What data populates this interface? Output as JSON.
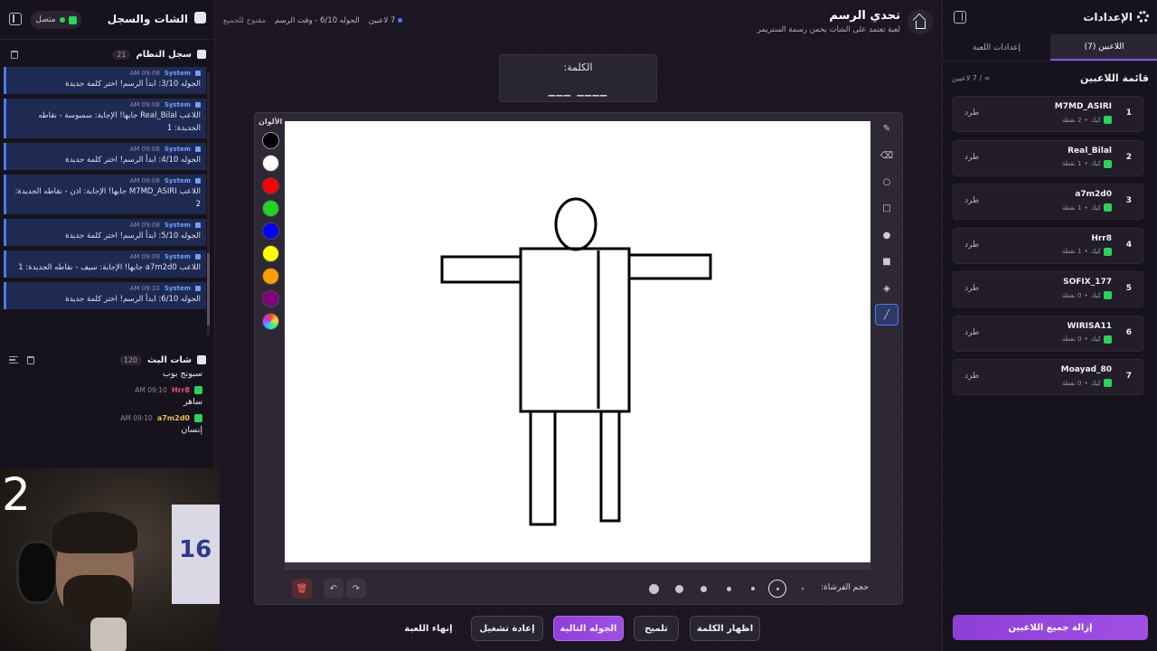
{
  "left_panel": {
    "title": "الشات والسجل",
    "status": "متصل",
    "system_log": {
      "title": "سجل النظام",
      "count": "21",
      "entries": [
        {
          "source": "System",
          "time": "09:08 AM",
          "text": "الجوله 3/10: ابدأ الرسم! اختر كلمة جديدة"
        },
        {
          "source": "System",
          "time": "09:08 AM",
          "text": "اللاعب Real_Bilal جابها! الإجابة: سمبوسة - نقاطه الجديدة: 1"
        },
        {
          "source": "System",
          "time": "09:08 AM",
          "text": "الجوله 4/10: ابدأ الرسم! اختر كلمة جديدة"
        },
        {
          "source": "System",
          "time": "09:08 AM",
          "text": "اللاعب M7MD_ASIRI جابها! الإجابة: اذن - نقاطه الجديدة: 2"
        },
        {
          "source": "System",
          "time": "09:08 AM",
          "text": "الجوله 5/10: ابدأ الرسم! اختر كلمة جديدة"
        },
        {
          "source": "System",
          "time": "09:09 AM",
          "text": "اللاعب a7m2d0 جابها! الإجابة: سيف - نقاطه الجديدة: 1"
        },
        {
          "source": "System",
          "time": "09:10 AM",
          "text": "الجوله 6/10: ابدأ الرسم! اختر كلمة جديدة"
        }
      ]
    },
    "stream_chat": {
      "title": "شات البث",
      "count": "120",
      "messages": [
        {
          "user": "",
          "time": "",
          "text": "سبونج بوب",
          "color": "#ffffff"
        },
        {
          "user": "Hrr8",
          "time": "09:10 AM",
          "text": "ساهر",
          "color": "#e0566b"
        },
        {
          "user": "a7m2d0",
          "time": "09:10 AM",
          "text": "إنسان",
          "color": "#e8c25a"
        }
      ]
    },
    "webcam": {
      "overlay_number": "2",
      "poster_text": "16"
    }
  },
  "header": {
    "title": "تحدي الرسم",
    "subtitle": "لعبة تعتمد على الشات يخمن رسمة الستريمر",
    "players_online": "7 لاعبين",
    "round_info": "الجوله 6/10 - وقت الرسم",
    "open_for_all": "مفتوح للجميع"
  },
  "word_box": {
    "label": "الكلمة:",
    "blanks": "___  ____"
  },
  "board": {
    "colors_label": "الألوان",
    "colors": [
      "#000000",
      "#ffffff",
      "#ff0000",
      "#22d322",
      "#0000ff",
      "#ffff00",
      "#ff9f00",
      "#800080",
      "rainbow"
    ],
    "brush_size_label": "حجم الفرشاة:",
    "tools": [
      "brush-icon",
      "eraser-icon",
      "circle-icon",
      "rectangle-icon",
      "filled-circle-icon",
      "filled-rectangle-icon",
      "fill-bucket-icon",
      "line-icon"
    ]
  },
  "bottom_buttons": {
    "end_game": "إنهاء اللعبة",
    "restart": "إعادة تشغيل",
    "next_round": "الجوله التالية",
    "hint": "تلميح",
    "show_word": "اظهار الكلمة"
  },
  "right_panel": {
    "title": "الإعدادات",
    "tabs": [
      "اللاعبين (7)",
      "إعدادات اللعبة"
    ],
    "players_title": "قائمة اللاعبين",
    "players_count": "∞ / 7 لاعبين",
    "kick_label": "طرد",
    "platform": "كيك",
    "players": [
      {
        "rank": "1",
        "name": "M7MD_ASIRI",
        "points": "2 نقطة"
      },
      {
        "rank": "2",
        "name": "Real_Bilal",
        "points": "1 نقطة"
      },
      {
        "rank": "3",
        "name": "a7m2d0",
        "points": "1 نقطة"
      },
      {
        "rank": "4",
        "name": "Hrr8",
        "points": "1 نقطة"
      },
      {
        "rank": "5",
        "name": "SOFIX_177",
        "points": "0 نقطة"
      },
      {
        "rank": "6",
        "name": "WIRISA11",
        "points": "0 نقطة"
      },
      {
        "rank": "7",
        "name": "Moayad_80",
        "points": "0 نقطة"
      }
    ],
    "remove_all": "إزالة جميع اللاعبين"
  }
}
